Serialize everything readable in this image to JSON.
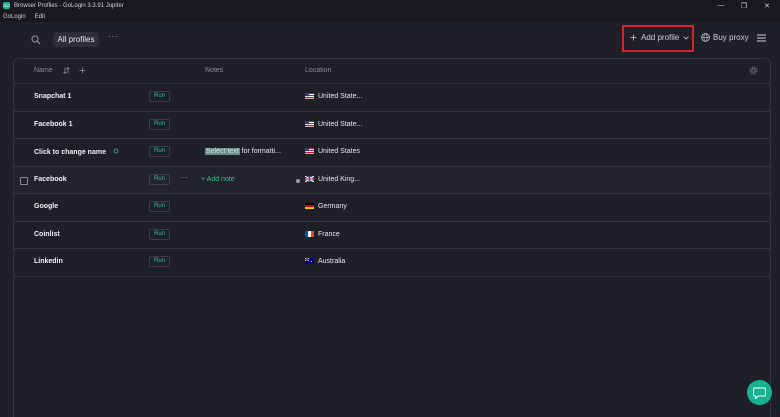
{
  "window": {
    "title": "Browser Profiles - GoLogin 3.3.91 Jupiter",
    "logo_text": "GO",
    "controls": [
      "—",
      "❐",
      "✕"
    ]
  },
  "menu": [
    "GoLogin",
    "Edit"
  ],
  "toolbar": {
    "filter_label": "All profiles",
    "more_label": "···",
    "add_profile_label": "Add profile",
    "buy_proxy_label": "Buy proxy"
  },
  "table": {
    "headers": {
      "name": "Name",
      "notes": "Notes",
      "location": "Location"
    },
    "rows": [
      {
        "name": "Snapchat 1",
        "run": "Run",
        "notes": "",
        "location": "United State...",
        "flag": "us"
      },
      {
        "name": "Facebook 1",
        "run": "Run",
        "notes": "",
        "location": "United State...",
        "flag": "us"
      },
      {
        "name": "Click to change name",
        "run": "Run",
        "notes_sel": "Select text",
        "notes_rest": " for formatti...",
        "location": "United States",
        "flag": "us"
      },
      {
        "name": "Facebook",
        "run": "Run",
        "add_note": "+ Add note",
        "location": "United King...",
        "flag": "gb"
      },
      {
        "name": "Google",
        "run": "Run",
        "notes": "",
        "location": "Germany",
        "flag": "de"
      },
      {
        "name": "Coinlist",
        "run": "Run",
        "notes": "",
        "location": "France",
        "flag": "fr"
      },
      {
        "name": "Linkedin",
        "run": "Run",
        "notes": "",
        "location": "Australia",
        "flag": "au"
      }
    ]
  },
  "colors": {
    "accent": "#17b391",
    "highlight_box": "#d3232c",
    "background": "#1f1f27"
  }
}
